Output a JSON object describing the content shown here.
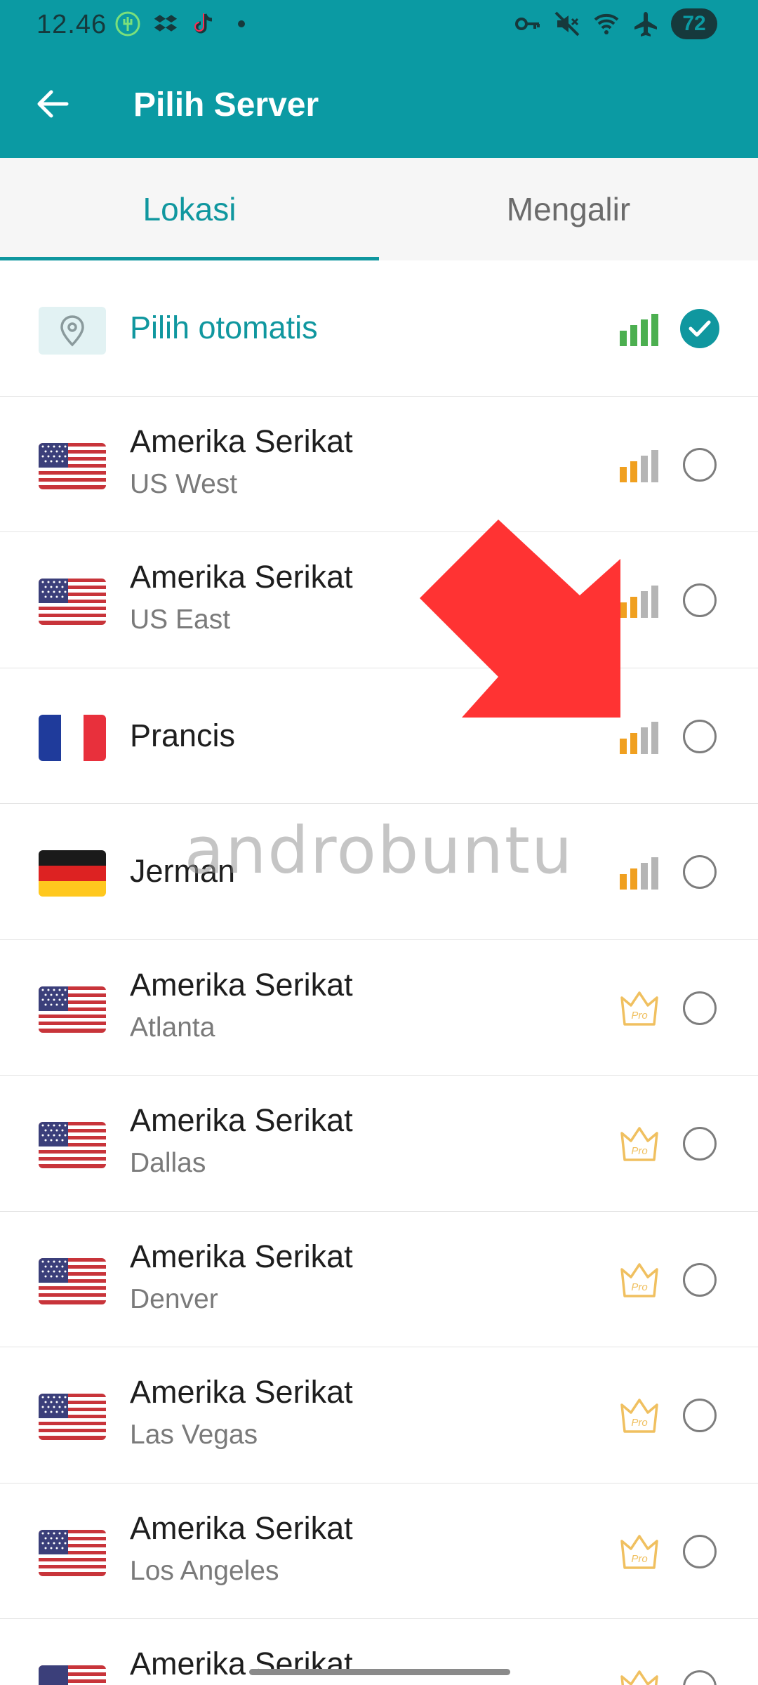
{
  "status_bar": {
    "time": "12.46",
    "battery": "72",
    "left_icons": [
      "app-icon",
      "dropbox-icon",
      "tiktok-icon",
      "dot-icon"
    ],
    "right_icons": [
      "vpn-key-icon",
      "mute-icon",
      "wifi-icon",
      "airplane-icon"
    ]
  },
  "app_bar": {
    "title": "Pilih Server",
    "back_icon": "arrow-left-icon"
  },
  "tabs": [
    {
      "label": "Lokasi",
      "active": true
    },
    {
      "label": "Mengalir",
      "active": false
    }
  ],
  "colors": {
    "primary": "#0b9aa3",
    "accent": "#10979f",
    "signal_good": "#4caf50",
    "signal_medium": "#f0a020",
    "signal_inactive": "#b5b5b5",
    "pro": "#f0c060",
    "arrow": "#ff3333"
  },
  "servers": [
    {
      "country": "Pilih otomatis",
      "city": "",
      "icon": "location-pin-icon",
      "signal_bars": 4,
      "pro": false,
      "selected": true
    },
    {
      "country": "Amerika Serikat",
      "city": "US West",
      "icon": "us-flag",
      "signal_bars": 2,
      "pro": false,
      "selected": false
    },
    {
      "country": "Amerika Serikat",
      "city": "US East",
      "icon": "us-flag",
      "signal_bars": 2,
      "pro": false,
      "selected": false
    },
    {
      "country": "Prancis",
      "city": "",
      "icon": "france-flag",
      "signal_bars": 2,
      "pro": false,
      "selected": false
    },
    {
      "country": "Jerman",
      "city": "",
      "icon": "germany-flag",
      "signal_bars": 2,
      "pro": false,
      "selected": false
    },
    {
      "country": "Amerika Serikat",
      "city": "Atlanta",
      "icon": "us-flag",
      "pro": true,
      "selected": false
    },
    {
      "country": "Amerika Serikat",
      "city": "Dallas",
      "icon": "us-flag",
      "pro": true,
      "selected": false
    },
    {
      "country": "Amerika Serikat",
      "city": "Denver",
      "icon": "us-flag",
      "pro": true,
      "selected": false
    },
    {
      "country": "Amerika Serikat",
      "city": "Las Vegas",
      "icon": "us-flag",
      "pro": true,
      "selected": false
    },
    {
      "country": "Amerika Serikat",
      "city": "Los Angeles",
      "icon": "us-flag",
      "pro": true,
      "selected": false
    },
    {
      "country": "Amerika Serikat",
      "city": "",
      "icon": "us-flag",
      "pro": true,
      "selected": false
    }
  ],
  "pro_badge_label": "Pro",
  "watermark": "androbuntu"
}
